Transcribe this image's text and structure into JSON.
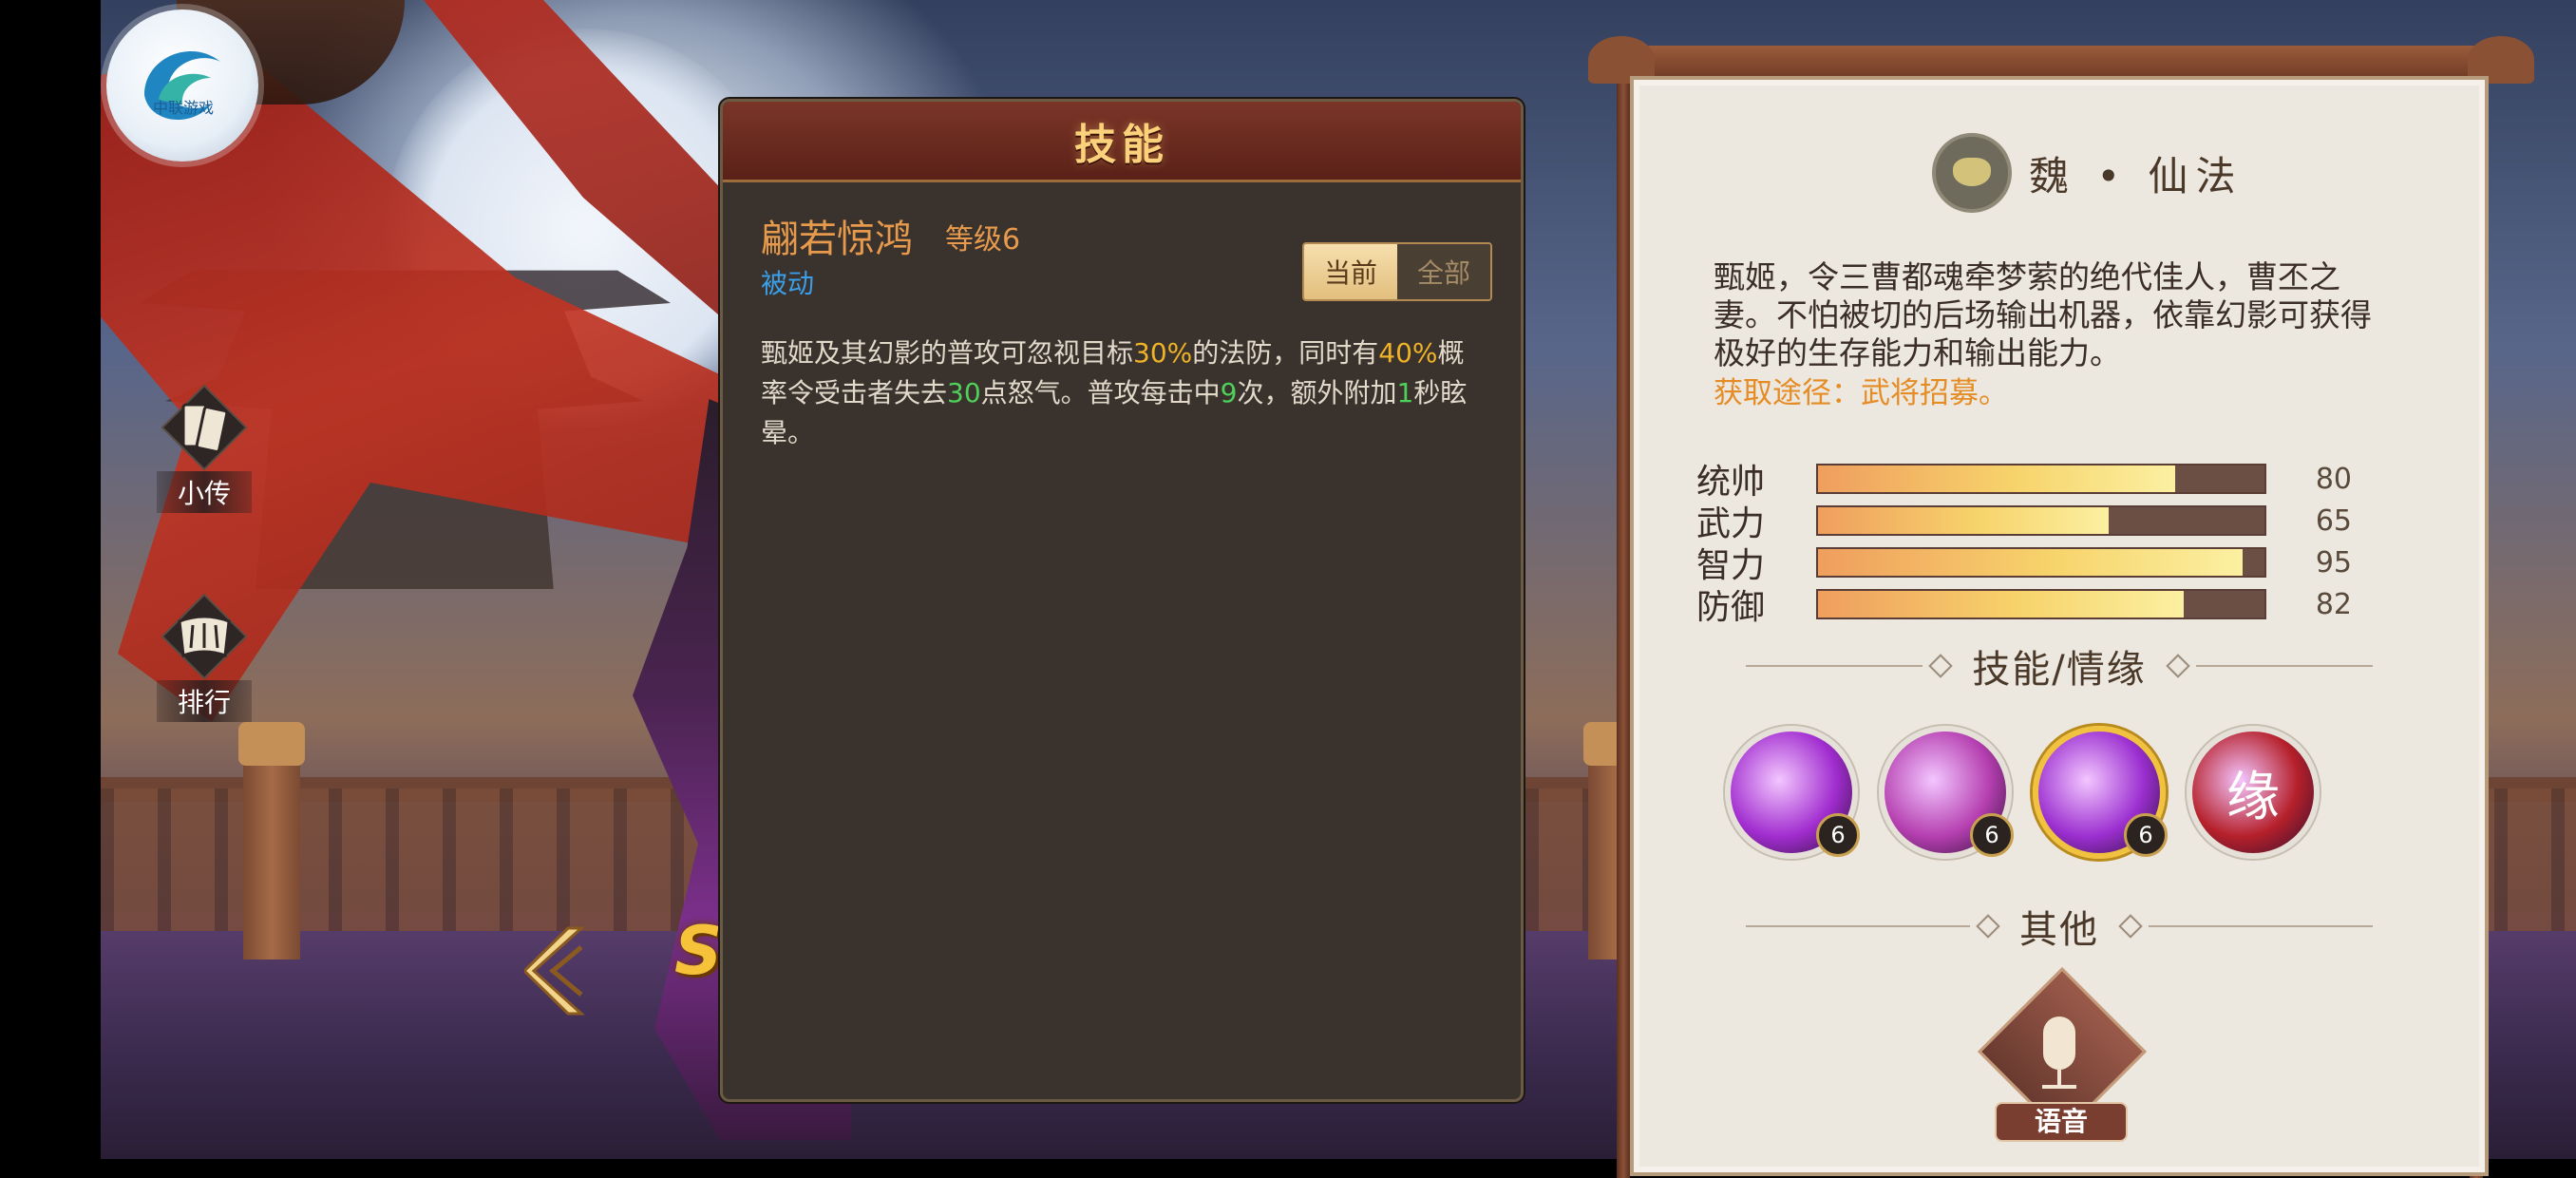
{
  "logo": {
    "text": "中联游戏"
  },
  "left_nav": [
    {
      "label": "小传",
      "icon": "cards-icon"
    },
    {
      "label": "排行",
      "icon": "scroll-icon"
    }
  ],
  "hero": {
    "rarity_badge": "SS"
  },
  "skill_panel": {
    "title": "技能",
    "skill_name": "翩若惊鸿",
    "skill_level": "等级6",
    "skill_type": "被动",
    "toggle": {
      "current": "当前",
      "all": "全部",
      "selected": "当前"
    },
    "description": {
      "p1": "甄姬及其幻影的普攻可忽视目标",
      "v1": "30%",
      "p2": "的法防，同时有",
      "v2": "40%",
      "p3": "概率令受击者失去",
      "v3": "30",
      "p4": "点怒气。普攻每击中",
      "v4": "9",
      "p5": "次，额外附加",
      "v5": "1",
      "p6": "秒眩晕。"
    }
  },
  "info_panel": {
    "faction": "魏 • 仙法",
    "bio": "甄姬，令三曹都魂牵梦萦的绝代佳人，曹丕之妻。不怕被切的后场输出机器，依靠幻影可获得极好的生存能力和输出能力。",
    "obtain": "获取途径：武将招募。",
    "stats": [
      {
        "name": "统帅",
        "value": 80
      },
      {
        "name": "武力",
        "value": 65
      },
      {
        "name": "智力",
        "value": 95
      },
      {
        "name": "防御",
        "value": 82
      }
    ],
    "skills_heading": "技能/情缘",
    "skills": [
      {
        "level": "6",
        "color": "#a12dcf",
        "selected": false
      },
      {
        "level": "6",
        "color": "#b53fb0",
        "selected": false
      },
      {
        "level": "6",
        "color": "#9b2fd0",
        "selected": true
      },
      {
        "glyph": "缘",
        "color": "#b5202a"
      }
    ],
    "other_heading": "其他",
    "voice_label": "语音"
  }
}
